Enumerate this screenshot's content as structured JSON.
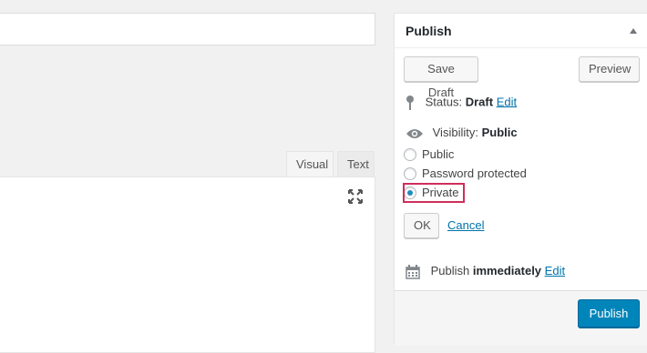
{
  "editor": {
    "tabs": {
      "visual": "Visual",
      "text": "Text"
    }
  },
  "publish": {
    "title": "Publish",
    "save_draft_label": "Save Draft",
    "preview_label": "Preview",
    "status_label": "Status:",
    "status_value": "Draft",
    "status_edit": "Edit",
    "visibility_label": "Visibility:",
    "visibility_value": "Public",
    "options": [
      "Public",
      "Password protected",
      "Private"
    ],
    "selected_option": "Private",
    "ok_label": "OK",
    "cancel_label": "Cancel",
    "publish_text": "Publish",
    "publish_when": "immediately",
    "publish_edit": "Edit",
    "publish_button": "Publish"
  },
  "colors": {
    "accent": "#0085ba",
    "link": "#0073aa",
    "highlight": "#d12d5b"
  },
  "icons": [
    "pin-icon",
    "eye-icon",
    "calendar-icon",
    "expand-icon",
    "collapse-arrow-icon"
  ]
}
